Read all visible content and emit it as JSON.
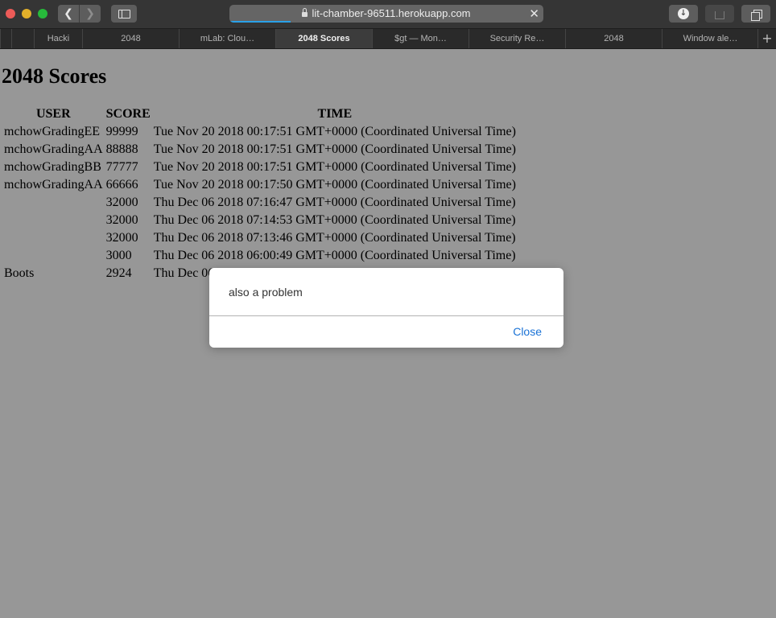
{
  "browser": {
    "url": "lit-chamber-96511.herokuapp.com",
    "tabs": [
      {
        "label": "Hacki",
        "active": false
      },
      {
        "label": "2048",
        "active": false
      },
      {
        "label": "mLab: Clou…",
        "active": false
      },
      {
        "label": "2048 Scores",
        "active": true
      },
      {
        "label": "$gt — Mon…",
        "active": false
      },
      {
        "label": "Security Re…",
        "active": false
      },
      {
        "label": "2048",
        "active": false
      },
      {
        "label": "Window ale…",
        "active": false
      }
    ],
    "icons": {
      "back": "chevron-left-icon",
      "forward": "chevron-right-icon",
      "sidebar": "sidebar-icon",
      "lock": "lock-icon",
      "stop": "close-icon",
      "download": "download-icon",
      "share": "share-icon",
      "tabs": "tab-overview-icon",
      "new_tab": "plus-icon"
    }
  },
  "page": {
    "title": "2048 Scores",
    "columns": [
      "USER",
      "SCORE",
      "TIME"
    ],
    "rows": [
      {
        "user": "mchowGradingEE",
        "score": "99999",
        "time": "Tue Nov 20 2018 00:17:51 GMT+0000 (Coordinated Universal Time)"
      },
      {
        "user": "mchowGradingAA",
        "score": "88888",
        "time": "Tue Nov 20 2018 00:17:51 GMT+0000 (Coordinated Universal Time)"
      },
      {
        "user": "mchowGradingBB",
        "score": "77777",
        "time": "Tue Nov 20 2018 00:17:51 GMT+0000 (Coordinated Universal Time)"
      },
      {
        "user": "mchowGradingAA",
        "score": "66666",
        "time": "Tue Nov 20 2018 00:17:50 GMT+0000 (Coordinated Universal Time)"
      },
      {
        "user": "",
        "score": "32000",
        "time": "Thu Dec 06 2018 07:16:47 GMT+0000 (Coordinated Universal Time)"
      },
      {
        "user": "",
        "score": "32000",
        "time": "Thu Dec 06 2018 07:14:53 GMT+0000 (Coordinated Universal Time)"
      },
      {
        "user": "",
        "score": "32000",
        "time": "Thu Dec 06 2018 07:13:46 GMT+0000 (Coordinated Universal Time)"
      },
      {
        "user": "",
        "score": "3000",
        "time": "Thu Dec 06 2018 06:00:49 GMT+0000 (Coordinated Universal Time)"
      },
      {
        "user": "Boots",
        "score": "2924",
        "time": "Thu Dec 06"
      }
    ]
  },
  "alert": {
    "message": "also a problem",
    "close_label": "Close"
  },
  "colors": {
    "page_overlay": "#979797",
    "link_blue": "#1a72d6",
    "progress_blue": "#2aa1e8"
  }
}
